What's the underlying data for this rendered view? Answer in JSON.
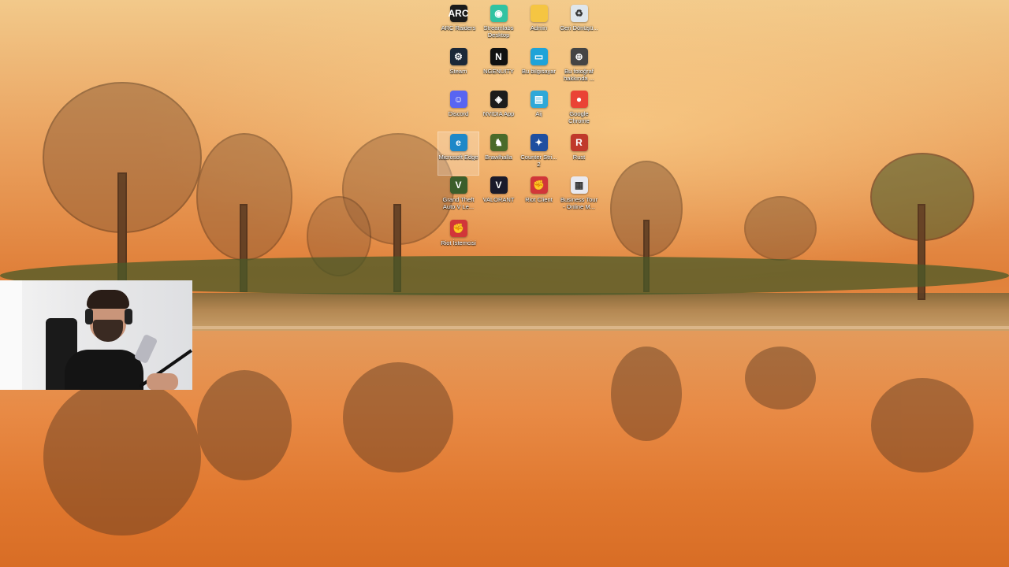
{
  "desktop": {
    "icons": [
      {
        "label": "ARC Raiders",
        "icon": "arc-raiders-icon",
        "color": "#1b1b1b",
        "glyph": "ARC"
      },
      {
        "label": "Streamlabs Desktop",
        "icon": "streamlabs-icon",
        "color": "#31c3a2",
        "glyph": "◉"
      },
      {
        "label": "Admin",
        "icon": "folder-icon",
        "color": "#f5c542",
        "glyph": ""
      },
      {
        "label": "Geri Dönüşü...",
        "icon": "recycle-bin-icon",
        "color": "#dfe6ec",
        "glyph": "♻"
      },
      {
        "label": "Steam",
        "icon": "steam-icon",
        "color": "#1b2838",
        "glyph": "⚙"
      },
      {
        "label": "NGENUITY",
        "icon": "ngenuity-icon",
        "color": "#111111",
        "glyph": "N"
      },
      {
        "label": "Bu bilgisayar",
        "icon": "this-pc-icon",
        "color": "#1fa3d8",
        "glyph": "▭"
      },
      {
        "label": "Bu fotoğraf hakkında ...",
        "icon": "photo-info-icon",
        "color": "#444444",
        "glyph": "⊕"
      },
      {
        "label": "Discord",
        "icon": "discord-icon",
        "color": "#5865f2",
        "glyph": "☺"
      },
      {
        "label": "NVIDIA App",
        "icon": "nvidia-icon",
        "color": "#1c1c1c",
        "glyph": "◈"
      },
      {
        "label": "Aij",
        "icon": "app-icon",
        "color": "#2fa8d8",
        "glyph": "▤"
      },
      {
        "label": "Google Chrome",
        "icon": "chrome-icon",
        "color": "#ea4335",
        "glyph": "●"
      },
      {
        "label": "Microsoft Edge",
        "icon": "edge-icon",
        "color": "#1e88c8",
        "glyph": "e"
      },
      {
        "label": "Brawlhalla",
        "icon": "brawlhalla-icon",
        "color": "#4a6b2a",
        "glyph": "♞"
      },
      {
        "label": "Counter Stri... 2",
        "icon": "counter-strike-icon",
        "color": "#1f4fa0",
        "glyph": "✦"
      },
      {
        "label": "Rust",
        "icon": "rust-icon",
        "color": "#c0392b",
        "glyph": "R"
      },
      {
        "label": "Grand Theft Auto V Le...",
        "icon": "gta-icon",
        "color": "#3b5e2b",
        "glyph": "V"
      },
      {
        "label": "VALORANT",
        "icon": "valorant-icon",
        "color": "#1a1a2a",
        "glyph": "V"
      },
      {
        "label": "Riot Client",
        "icon": "riot-client-icon",
        "color": "#d13639",
        "glyph": "✊"
      },
      {
        "label": "Business Tour - Online M...",
        "icon": "business-tour-icon",
        "color": "#e9e9ef",
        "glyph": "▦"
      },
      {
        "label": "Riot İstemcisi",
        "icon": "riot-client-icon",
        "color": "#d13639",
        "glyph": "✊"
      }
    ],
    "selected_icon": "Microsoft Edge"
  }
}
